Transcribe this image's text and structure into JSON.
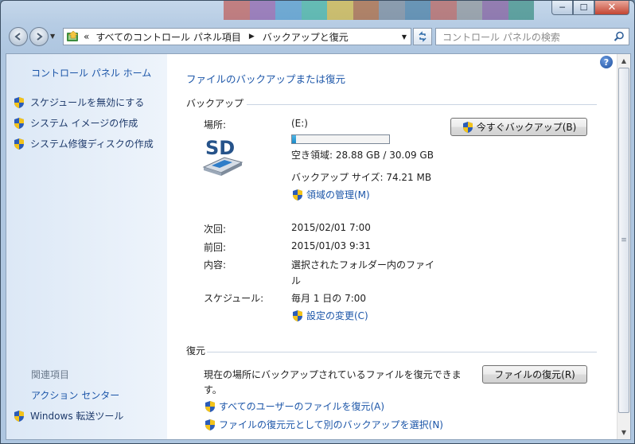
{
  "window": {
    "close_glyph": "✕",
    "minimize_glyph": "─",
    "maximize_glyph": "☐"
  },
  "nav": {
    "breadcrumb_overflow": "«",
    "breadcrumbs": [
      "すべてのコントロール パネル項目",
      "バックアップと復元"
    ],
    "search_placeholder": "コントロール パネルの検索"
  },
  "left_pane": {
    "home_link": "コントロール パネル ホーム",
    "tasks": [
      "スケジュールを無効にする",
      "システム イメージの作成",
      "システム修復ディスクの作成"
    ],
    "related_title": "関連項目",
    "related": [
      "アクション センター",
      "Windows 転送ツール"
    ]
  },
  "main": {
    "heading_link": "ファイルのバックアップまたは復元",
    "backup": {
      "section_title": "バックアップ",
      "location_label": "場所:",
      "drive": "(E:)",
      "drive_icon_text": "SD",
      "free_space": "空き領域: 28.88 GB / 30.09 GB",
      "capacity_used_fraction": 0.04,
      "backup_size": "バックアップ サイズ: 74.21 MB",
      "manage_space_link": "領域の管理(M)",
      "backup_now_button": "今すぐバックアップ(B)",
      "next_label": "次回:",
      "next_value": "2015/02/01 7:00",
      "last_label": "前回:",
      "last_value": "2015/01/03 9:31",
      "contents_label": "内容:",
      "contents_value_line1": "選択されたフォルダー内のファイ",
      "contents_value_line2": "ル",
      "schedule_label": "スケジュール:",
      "schedule_value": "毎月 1 日の 7:00",
      "change_settings_link": "設定の変更(C)"
    },
    "restore": {
      "section_title": "復元",
      "description_line1": "現在の場所にバックアップされているファイルを復元できま",
      "description_line2": "す。",
      "restore_button": "ファイルの復元(R)",
      "restore_all_users_link": "すべてのユーザーのファイルを復元(A)",
      "select_other_backup_link": "ファイルの復元元として別のバックアップを選択(N)"
    }
  },
  "colors": {
    "link": "#1b55a8",
    "nav_link": "#1e3a6b",
    "progress": "#1a8ac7"
  }
}
